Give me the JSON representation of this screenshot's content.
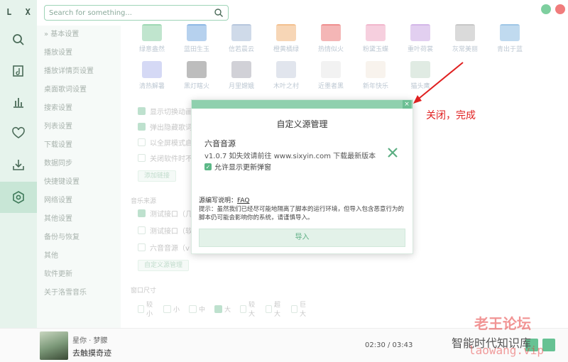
{
  "app": {
    "logo": "L X"
  },
  "search": {
    "placeholder": "Search for something..."
  },
  "window_buttons": [
    {
      "name": "minimize-button",
      "color": "#7ecf9f"
    },
    {
      "name": "close-window-button",
      "color": "#f07c7c"
    }
  ],
  "rail": [
    {
      "name": "rail-search-icon",
      "icon": "search-icon"
    },
    {
      "name": "rail-songlist-icon",
      "icon": "music-note-icon"
    },
    {
      "name": "rail-leaderboard-icon",
      "icon": "bar-chart-icon"
    },
    {
      "name": "rail-favorite-icon",
      "icon": "heart-icon"
    },
    {
      "name": "rail-download-icon",
      "icon": "download-icon"
    },
    {
      "name": "rail-settings-icon",
      "icon": "settings-icon",
      "active": true
    }
  ],
  "nav": {
    "items": [
      "» 基本设置",
      "播放设置",
      "播放详情页设置",
      "桌面歌词设置",
      "搜索设置",
      "列表设置",
      "下载设置",
      "数据同步",
      "快捷键设置",
      "网络设置",
      "其他设置",
      "备份与恢复",
      "其他",
      "软件更新",
      "关于洛雪音乐"
    ]
  },
  "themes": {
    "row1": [
      "绿意盎然",
      "蓝田生玉",
      "信若晨云",
      "橙黄橘绿",
      "热情似火",
      "粉黛玉蝶",
      "重叶荷裳",
      "灰常美丽",
      "青出于蓝"
    ],
    "row1_colors": [
      "#9fd8b4",
      "#8fb9e5",
      "#b6c6dd",
      "#f3c08f",
      "#ef8f8f",
      "#f1b6cc",
      "#d3b6e8",
      "#c7c7c7",
      "#9fc6e6"
    ],
    "row2": [
      "清热解暑",
      "黑灯瞎火",
      "月里嫦娥",
      "木叶之村",
      "近墨者黑",
      "新年快乐",
      "猫头鹰"
    ],
    "row2_colors": [
      "#bfc5f0",
      "#9a9a9a",
      "#b9b9c2",
      "#d2d8e4",
      "#ececec",
      "#f4ede4",
      "#cfe0d4"
    ]
  },
  "settings": {
    "checks_top": [
      {
        "label": "显示切换动画",
        "on": true
      },
      {
        "label": "弹出隐藏歌词",
        "on": true
      },
      {
        "label": "以全屏模式启动",
        "on": false
      },
      {
        "label": "关闭软件时不退出",
        "on": false
      }
    ],
    "button_1": "添加链接",
    "music_source_title": "音乐来源",
    "source_checks": [
      {
        "label": "测试接口（几",
        "on": true
      },
      {
        "label": "测试接口（软",
        "on": false
      },
      {
        "label": "六音音源（v",
        "on": false
      }
    ],
    "button_2": "自定义源管理",
    "window_size_title": "窗口尺寸",
    "sizes": [
      {
        "label": "较小",
        "on": false
      },
      {
        "label": "小",
        "on": false
      },
      {
        "label": "中",
        "on": false
      },
      {
        "label": "大",
        "on": true
      },
      {
        "label": "较大",
        "on": false
      },
      {
        "label": "超大",
        "on": false
      },
      {
        "label": "巨大",
        "on": false
      }
    ]
  },
  "dialog": {
    "close_glyph": "×",
    "title": "自定义源管理",
    "source_name": "六音音源",
    "source_desc": "v1.0.7 如失效请前往 www.sixyin.com 下载最新版本",
    "allow_update_label": "允许显示更新弹窗",
    "allow_update_checked": true,
    "check_glyph": "✓",
    "doc_label": "源编写说明：",
    "doc_link": "FAQ",
    "tip": "提示：虽然我们已经尽可能地隔离了脚本的运行环境，但导入包含恶意行为的脚本仍可能会影响你的系统，请谨慎导入。",
    "import_button": "导入"
  },
  "annotation": {
    "text": "关闭，完成",
    "color": "#e02020"
  },
  "player": {
    "artist": "星你 · 梦朦",
    "title": "去触摸奇迹",
    "time": "02:30 / 03:43"
  },
  "watermark": {
    "line1": "智能时代知识库",
    "line2": "老王论坛",
    "line3": "laowang.vip"
  },
  "colors": {
    "accent": "#5cb887",
    "rail_bg": "#e6f3ec",
    "dialog_bar": "#8fd0ae"
  }
}
